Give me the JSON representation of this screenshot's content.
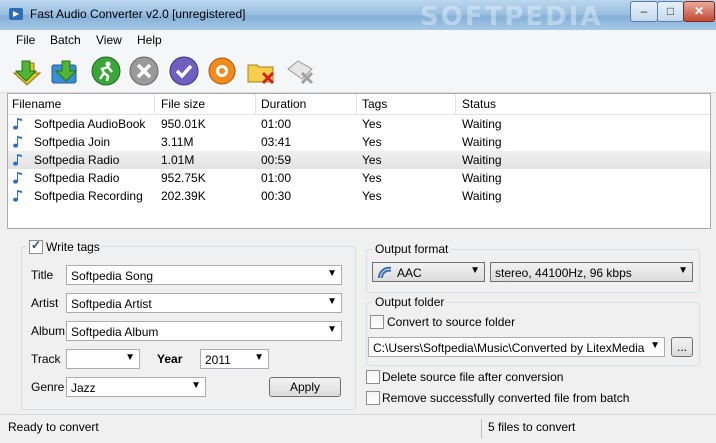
{
  "window": {
    "title": "Fast Audio Converter v2.0 [unregistered]",
    "watermark": "SOFTPEDIA"
  },
  "menu": [
    "File",
    "Batch",
    "View",
    "Help"
  ],
  "toolbar": [
    {
      "name": "add-files-icon"
    },
    {
      "name": "add-folder-icon"
    },
    {
      "name": "convert-run-icon"
    },
    {
      "name": "stop-icon"
    },
    {
      "name": "check-icon"
    },
    {
      "name": "settings-icon"
    },
    {
      "name": "remove-folder-icon"
    },
    {
      "name": "clear-list-icon"
    }
  ],
  "list": {
    "columns": [
      "Filename",
      "File size",
      "Duration",
      "Tags",
      "Status"
    ],
    "rows": [
      [
        "Softpedia AudioBook",
        "950.01K",
        "01:00",
        "Yes",
        "Waiting"
      ],
      [
        "Softpedia Join",
        "3.11M",
        "03:41",
        "Yes",
        "Waiting"
      ],
      [
        "Softpedia Radio",
        "1.01M",
        "00:59",
        "Yes",
        "Waiting"
      ],
      [
        "Softpedia Radio",
        "952.75K",
        "01:00",
        "Yes",
        "Waiting"
      ],
      [
        "Softpedia Recording",
        "202.39K",
        "00:30",
        "Yes",
        "Waiting"
      ]
    ],
    "selected_row": 2
  },
  "tags": {
    "write_tags_label": "Write tags",
    "write_tags_checked": true,
    "title_label": "Title",
    "title_value": "Softpedia Song",
    "artist_label": "Artist",
    "artist_value": "Softpedia Artist",
    "album_label": "Album",
    "album_value": "Softpedia Album",
    "track_label": "Track",
    "track_value": "",
    "year_label": "Year",
    "year_value": "2011",
    "genre_label": "Genre",
    "genre_value": "Jazz",
    "apply_label": "Apply"
  },
  "output": {
    "format_label": "Output format",
    "format_value": "AAC",
    "quality_value": "stereo, 44100Hz, 96 kbps",
    "folder_label": "Output folder",
    "convert_to_source_label": "Convert to source folder",
    "convert_to_source_checked": false,
    "folder_path": "C:\\Users\\Softpedia\\Music\\Converted by LitexMedia",
    "browse_label": "...",
    "delete_source_label": "Delete source file after conversion",
    "delete_source_checked": false,
    "remove_converted_label": "Remove successfully converted file from batch",
    "remove_converted_checked": false
  },
  "status": {
    "left": "Ready to convert",
    "right": "5 files to convert"
  }
}
